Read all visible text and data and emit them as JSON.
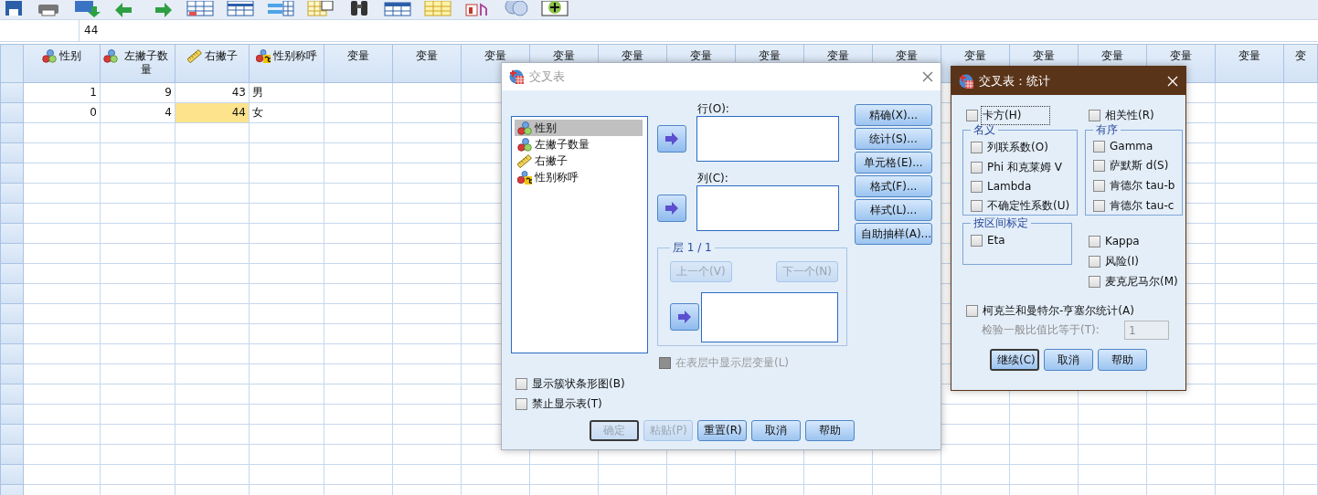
{
  "formula_bar": {
    "value": "44"
  },
  "data_grid": {
    "columns": [
      {
        "label": "性别",
        "kind": "nominal"
      },
      {
        "label": "左撇子数量",
        "kind": "nominal"
      },
      {
        "label": "右撇子",
        "kind": "scale"
      },
      {
        "label": "性别称呼",
        "kind": "string"
      },
      {
        "label": "变量",
        "kind": "empty"
      },
      {
        "label": "变量",
        "kind": "empty"
      },
      {
        "label": "变量",
        "kind": "empty"
      },
      {
        "label": "变量",
        "kind": "empty"
      },
      {
        "label": "变量",
        "kind": "empty"
      },
      {
        "label": "变量",
        "kind": "empty"
      },
      {
        "label": "变量",
        "kind": "empty"
      },
      {
        "label": "变量",
        "kind": "empty"
      },
      {
        "label": "变量",
        "kind": "empty"
      },
      {
        "label": "变量",
        "kind": "empty"
      },
      {
        "label": "变量",
        "kind": "empty"
      },
      {
        "label": "变量",
        "kind": "empty"
      },
      {
        "label": "变量",
        "kind": "empty"
      },
      {
        "label": "变量",
        "kind": "empty"
      },
      {
        "label": "变",
        "kind": "empty"
      }
    ],
    "rows": [
      {
        "cells": [
          {
            "text": "1",
            "selected": false
          },
          {
            "text": "9",
            "selected": false
          },
          {
            "text": "43",
            "selected": false
          },
          {
            "text": "男",
            "selected": false
          }
        ]
      },
      {
        "cells": [
          {
            "text": "0",
            "selected": false
          },
          {
            "text": "4",
            "selected": false
          },
          {
            "text": "44",
            "selected": true
          },
          {
            "text": "女",
            "selected": false
          }
        ]
      }
    ]
  },
  "crosstabs_dialog": {
    "title": "交叉表",
    "active": false,
    "variables": [
      {
        "label": "性别",
        "kind": "nominal",
        "selected": true
      },
      {
        "label": "左撇子数量",
        "kind": "nominal",
        "selected": false
      },
      {
        "label": "右撇子",
        "kind": "scale",
        "selected": false
      },
      {
        "label": "性别称呼",
        "kind": "string",
        "selected": false
      }
    ],
    "row_label": "行(O):",
    "column_label": "列(C):",
    "layer": {
      "title": "层 1 / 1",
      "previous": {
        "label": "上一个(V)",
        "disabled": true
      },
      "next": {
        "label": "下一个(N)",
        "disabled": true
      }
    },
    "display_layer_variables": {
      "label": "在表层中显示层变量(L)",
      "checked": false,
      "disabled": true
    },
    "side_buttons": [
      "精确(X)...",
      "统计(S)...",
      "单元格(E)...",
      "格式(F)...",
      "样式(L)...",
      "自助抽样(A)..."
    ],
    "options": [
      {
        "label": "显示簇状条形图(B)",
        "checked": false
      },
      {
        "label": "禁止显示表(T)",
        "checked": false
      }
    ],
    "buttons": [
      {
        "label": "确定",
        "disabled": true,
        "default": true
      },
      {
        "label": "粘贴(P)",
        "disabled": true,
        "default": false
      },
      {
        "label": "重置(R)",
        "disabled": false,
        "default": false
      },
      {
        "label": "取消",
        "disabled": false,
        "default": false
      },
      {
        "label": "帮助",
        "disabled": false,
        "default": false
      }
    ]
  },
  "statistics_dialog": {
    "title": "交叉表：统计",
    "active": true,
    "chi_square": {
      "label": "卡方(H)",
      "checked": false,
      "focused": true
    },
    "correlations": {
      "label": "相关性(R)",
      "checked": false
    },
    "nominal": {
      "title": "名义",
      "items": [
        {
          "label": "列联系数(O)",
          "checked": false
        },
        {
          "label": "Phi 和克莱姆 V",
          "checked": false
        },
        {
          "label": "Lambda",
          "checked": false
        },
        {
          "label": "不确定性系数(U)",
          "checked": false
        }
      ]
    },
    "ordinal": {
      "title": "有序",
      "items": [
        {
          "label": "Gamma",
          "checked": false
        },
        {
          "label": "萨默斯 d(S)",
          "checked": false
        },
        {
          "label": "肯德尔 tau-b",
          "checked": false
        },
        {
          "label": "肯德尔 tau-c",
          "checked": false
        }
      ]
    },
    "interval": {
      "title": "按区间标定",
      "items": [
        {
          "label": "Eta",
          "checked": false
        }
      ]
    },
    "other": [
      {
        "label": "Kappa",
        "checked": false
      },
      {
        "label": "风险(I)",
        "checked": false
      },
      {
        "label": "麦克尼马尔(M)",
        "checked": false
      }
    ],
    "cochran": {
      "label": "柯克兰和曼特尔-亨塞尔统计(A)",
      "checked": false
    },
    "odds_ratio": {
      "label": "检验一般比值比等于(T):",
      "value": "1",
      "disabled": true
    },
    "buttons": [
      {
        "label": "继续(C)",
        "disabled": false,
        "default": true
      },
      {
        "label": "取消",
        "disabled": false,
        "default": false
      },
      {
        "label": "帮助",
        "disabled": false,
        "default": false
      }
    ]
  }
}
